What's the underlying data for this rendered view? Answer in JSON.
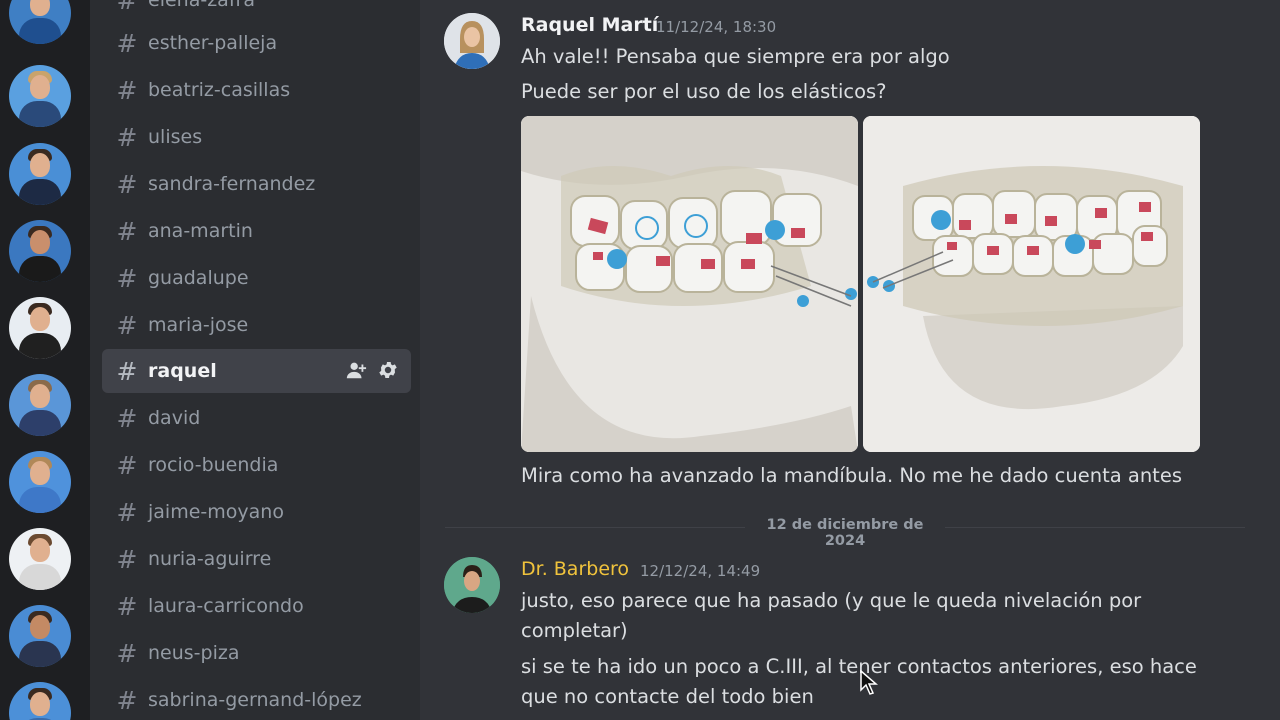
{
  "sidebar": {
    "partial_top": "elena-zafra",
    "channels": [
      {
        "name": "esther-palleja"
      },
      {
        "name": "beatriz-casillas"
      },
      {
        "name": "ulises"
      },
      {
        "name": "sandra-fernandez"
      },
      {
        "name": "ana-martin"
      },
      {
        "name": "guadalupe"
      },
      {
        "name": "maria-jose"
      },
      {
        "name": "raquel",
        "selected": true
      },
      {
        "name": "david"
      },
      {
        "name": "rocio-buendia"
      },
      {
        "name": "jaime-moyano"
      },
      {
        "name": "nuria-aguirre"
      },
      {
        "name": "laura-carricondo"
      },
      {
        "name": "neus-piza"
      },
      {
        "name": "sabrina-gernand-lópez"
      }
    ],
    "hash_glyph": "#"
  },
  "messages": [
    {
      "author": "Raquel Martí",
      "timestamp": "11/12/24, 18:30",
      "lines": [
        "Ah vale!! Pensaba que siempre era por algo",
        "Puede ser por el uso de los elásticos?",
        "Mira como ha avanzado la mandíbula. No me he dado cuenta antes"
      ]
    },
    {
      "author": "Dr. Barbero",
      "timestamp": "12/12/24, 14:49",
      "lines": [
        "justo, eso parece que ha pasado (y que le queda nivelación por",
        "completar)",
        "si se te ha ido un poco a C.III, al tener contactos anteriores, eso hace",
        "que no contacte del todo bien"
      ]
    }
  ],
  "date_divider": "12 de diciembre de 2024",
  "colors": {
    "bg": "#313338",
    "sidebar": "#2b2d31",
    "rail": "#1e1f22",
    "selected": "#404249",
    "gold_name": "#f0c33c"
  },
  "icons": [
    "hash-icon",
    "add-member-icon",
    "gear-icon",
    "mouse-cursor-icon"
  ]
}
